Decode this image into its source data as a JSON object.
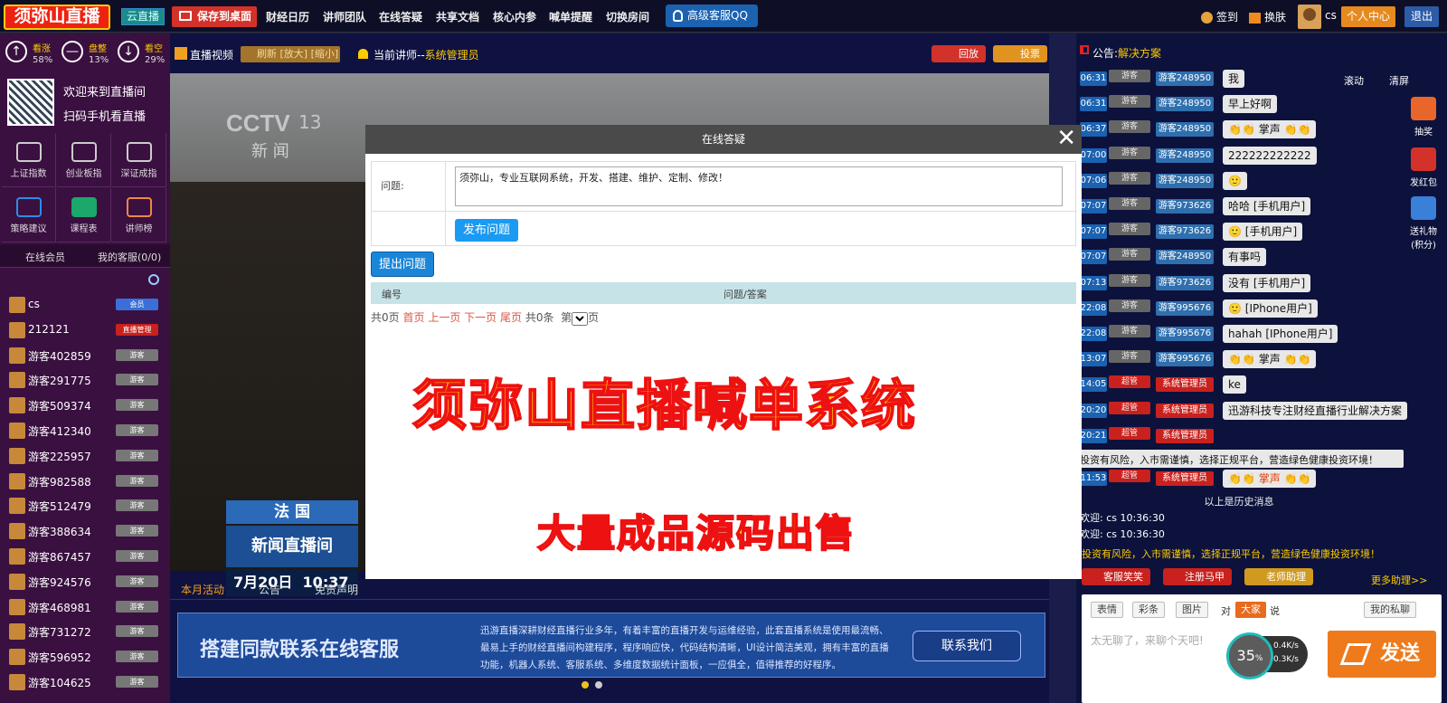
{
  "topbar": {
    "logo": "须弥山直播",
    "cloud_badge": "云直播",
    "save_desktop": "保存到桌面",
    "nav": [
      "财经日历",
      "讲师团队",
      "在线答疑",
      "共享文档",
      "核心内参",
      "喊单提醒",
      "切换房间"
    ],
    "qq": "高级客服QQ",
    "signin": "签到",
    "skin": "换肤",
    "username": "cs",
    "personal_center": "个人中心",
    "logout": "退出"
  },
  "sentiment": [
    {
      "label": "看涨",
      "pct": "58%",
      "icon": "↑"
    },
    {
      "label": "盘整",
      "pct": "13%",
      "icon": "—"
    },
    {
      "label": "看空",
      "pct": "29%",
      "icon": "↓"
    }
  ],
  "welcome": [
    "欢迎来到直播间",
    "扫码手机看直播"
  ],
  "tiles": [
    "上证指数",
    "创业板指",
    "深证成指",
    "策略建议",
    "课程表",
    "讲师榜"
  ],
  "left_tabs": [
    "在线会员",
    "我的客服(0/0)"
  ],
  "members": [
    {
      "name": "cs",
      "badge": "会员",
      "color": "#3a6fd8"
    },
    {
      "name": "212121",
      "badge": "直播管理",
      "color": "#c9211e"
    },
    {
      "name": "游客402859",
      "badge": "游客",
      "color": "#777"
    },
    {
      "name": "游客291775",
      "badge": "游客",
      "color": "#777"
    },
    {
      "name": "游客509374",
      "badge": "游客",
      "color": "#777"
    },
    {
      "name": "游客412340",
      "badge": "游客",
      "color": "#777"
    },
    {
      "name": "游客225957",
      "badge": "游客",
      "color": "#777"
    },
    {
      "name": "游客982588",
      "badge": "游客",
      "color": "#777"
    },
    {
      "name": "游客512479",
      "badge": "游客",
      "color": "#777"
    },
    {
      "name": "游客388634",
      "badge": "游客",
      "color": "#777"
    },
    {
      "name": "游客867457",
      "badge": "游客",
      "color": "#777"
    },
    {
      "name": "游客924576",
      "badge": "游客",
      "color": "#777"
    },
    {
      "name": "游客468981",
      "badge": "游客",
      "color": "#777"
    },
    {
      "name": "游客731272",
      "badge": "游客",
      "color": "#777"
    },
    {
      "name": "游客596952",
      "badge": "游客",
      "color": "#777"
    },
    {
      "name": "游客104625",
      "badge": "游客",
      "color": "#777"
    }
  ],
  "video": {
    "title": "直播视频",
    "refresh": "刷新 [放大] [缩小]",
    "teacher_prefix": "当前讲师--",
    "teacher_name": "系统管理员",
    "replay": "回放",
    "vote": "投票",
    "channel": "CCTV",
    "channel_num": "13",
    "channel_name": "新 闻",
    "country": "法 国",
    "live_title": "新闻直播间",
    "date": "7月20日",
    "time": "10:37"
  },
  "bottom_tabs": [
    "本月活动",
    "公告",
    "免责声明"
  ],
  "banner": {
    "headline": "搭建同款联系在线客服",
    "desc": "迅游直播深耕财经直播行业多年，有着丰富的直播开发与运维经验，此套直播系统是使用最流畅、最易上手的财经直播间构建程序，程序响应快，代码结构清晰，UI设计简洁美观，拥有丰富的直播功能，机器人系统、客服系统、多维度数据统计面板，一应俱全，值得推荐的好程序。",
    "button": "联系我们"
  },
  "notice": {
    "prefix": "公告:",
    "text": "解决方案"
  },
  "chat_controls": [
    "滚动",
    "清屏"
  ],
  "messages": [
    {
      "time": "06:31",
      "rank": "游客",
      "user": "游客248950",
      "text": "我",
      "red": false
    },
    {
      "time": "06:31",
      "rank": "游客",
      "user": "游客248950",
      "text": "早上好啊",
      "red": false
    },
    {
      "time": "06:37",
      "rank": "游客",
      "user": "游客248950",
      "text": "👏👏 掌声 👏👏",
      "red": false
    },
    {
      "time": "07:00",
      "rank": "游客",
      "user": "游客248950",
      "text": "222222222222",
      "red": false
    },
    {
      "time": "07:06",
      "rank": "游客",
      "user": "游客248950",
      "text": "🙂",
      "red": false
    },
    {
      "time": "07:07",
      "rank": "游客",
      "user": "游客973626",
      "text": "哈哈 [手机用户]",
      "red": false
    },
    {
      "time": "07:07",
      "rank": "游客",
      "user": "游客973626",
      "text": "🙂 [手机用户]",
      "red": false
    },
    {
      "time": "07:07",
      "rank": "游客",
      "user": "游客248950",
      "text": "有事吗",
      "red": false
    },
    {
      "time": "07:13",
      "rank": "游客",
      "user": "游客973626",
      "text": "没有 [手机用户]",
      "red": false
    },
    {
      "time": "22:08",
      "rank": "游客",
      "user": "游客995676",
      "text": "🙂 [IPhone用户]",
      "red": false
    },
    {
      "time": "22:08",
      "rank": "游客",
      "user": "游客995676",
      "text": "hahah [IPhone用户]",
      "red": false
    },
    {
      "time": "13:07",
      "rank": "游客",
      "user": "游客995676",
      "text": "👏👏 掌声 👏👏",
      "red": false
    },
    {
      "time": "14:05",
      "rank": "超管",
      "user": "系统管理员",
      "text": "ke",
      "red": true
    },
    {
      "time": "20:20",
      "rank": "超管",
      "user": "系统管理员",
      "text": "迅游科技专注财经直播行业解决方案",
      "red": true
    },
    {
      "time": "20:21",
      "rank": "超管",
      "user": "系统管理员",
      "text": "",
      "red": true
    }
  ],
  "risk_msg": "投资有风险，入市需谨慎，选择正规平台，营造绿色健康投资环境！",
  "last_msg": {
    "time": "11:53",
    "rank": "超管",
    "user": "系统管理员",
    "text": "👏👏 掌声 👏👏"
  },
  "history_label": "以上是历史消息",
  "sys_lines": [
    "欢迎: cs 10:36:30",
    "欢迎: cs 10:36:30"
  ],
  "side_tools": [
    "抽奖",
    "发红包",
    "送礼物(积分)"
  ],
  "chat_buttons": [
    "客服笑笑",
    "注册马甲",
    "老师助理"
  ],
  "more_help": "更多助理>>",
  "input": {
    "tools": [
      "表情",
      "彩条",
      "图片"
    ],
    "to": "对",
    "target": "大家",
    "say": "说",
    "private": "我的私聊",
    "placeholder": "太无聊了，来聊个天吧!",
    "speed_pct": "35",
    "up": "0.4K/s",
    "down": "0.3K/s",
    "send": "发送"
  },
  "modal": {
    "title": "在线答疑",
    "question_label": "问题:",
    "question_value": "须弥山，专业互联网系统，开发、搭建、维护、定制、修改！",
    "publish": "发布问题",
    "ask": "提出问题",
    "col_id": "编号",
    "col_qa": "问题/答案",
    "pager_total": "共0页",
    "pager_first": "首页",
    "pager_prev": "上一页",
    "pager_next": "下一页",
    "pager_last": "尾页",
    "pager_count": "共0条",
    "pager_page_prefix": "第",
    "pager_page_suffix": "页",
    "promo1": "须弥山直播喊单系统",
    "promo2": "大量成品源码出售"
  }
}
